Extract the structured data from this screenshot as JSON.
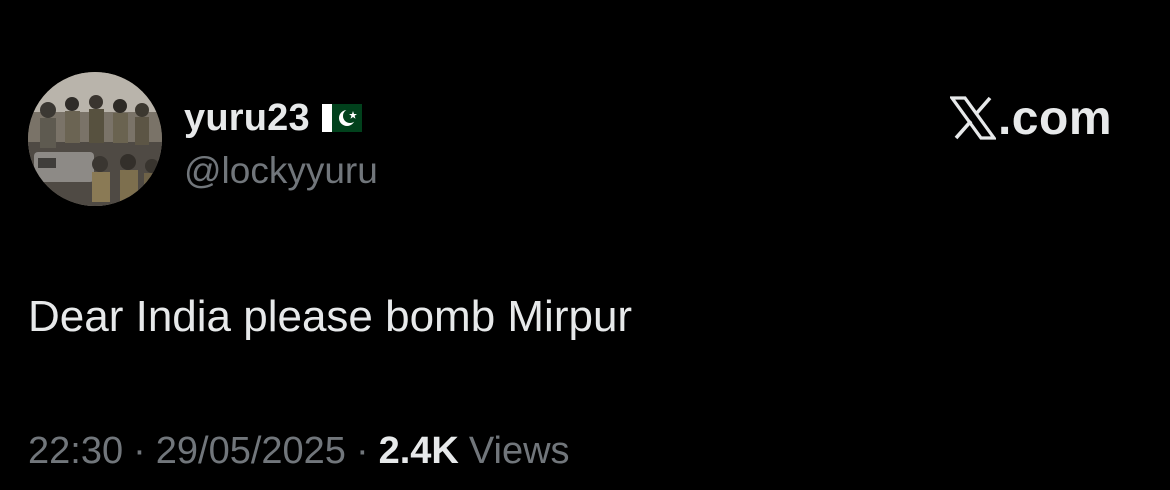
{
  "colors": {
    "background": "#000000",
    "primary_text": "#e7e9ea",
    "secondary_text": "#71767b"
  },
  "author": {
    "display_name": "yuru23",
    "flag_icon": "pakistan-flag-icon",
    "handle": "@lockyyuru",
    "avatar_icon": "profile-avatar"
  },
  "brand": {
    "logo_icon": "x-logo-icon",
    "domain": ".com"
  },
  "tweet": {
    "text": "Dear India please bomb Mirpur"
  },
  "meta": {
    "time": "22:30",
    "separator": "·",
    "date": "29/05/2025",
    "views_count": "2.4K",
    "views_label": "Views"
  }
}
